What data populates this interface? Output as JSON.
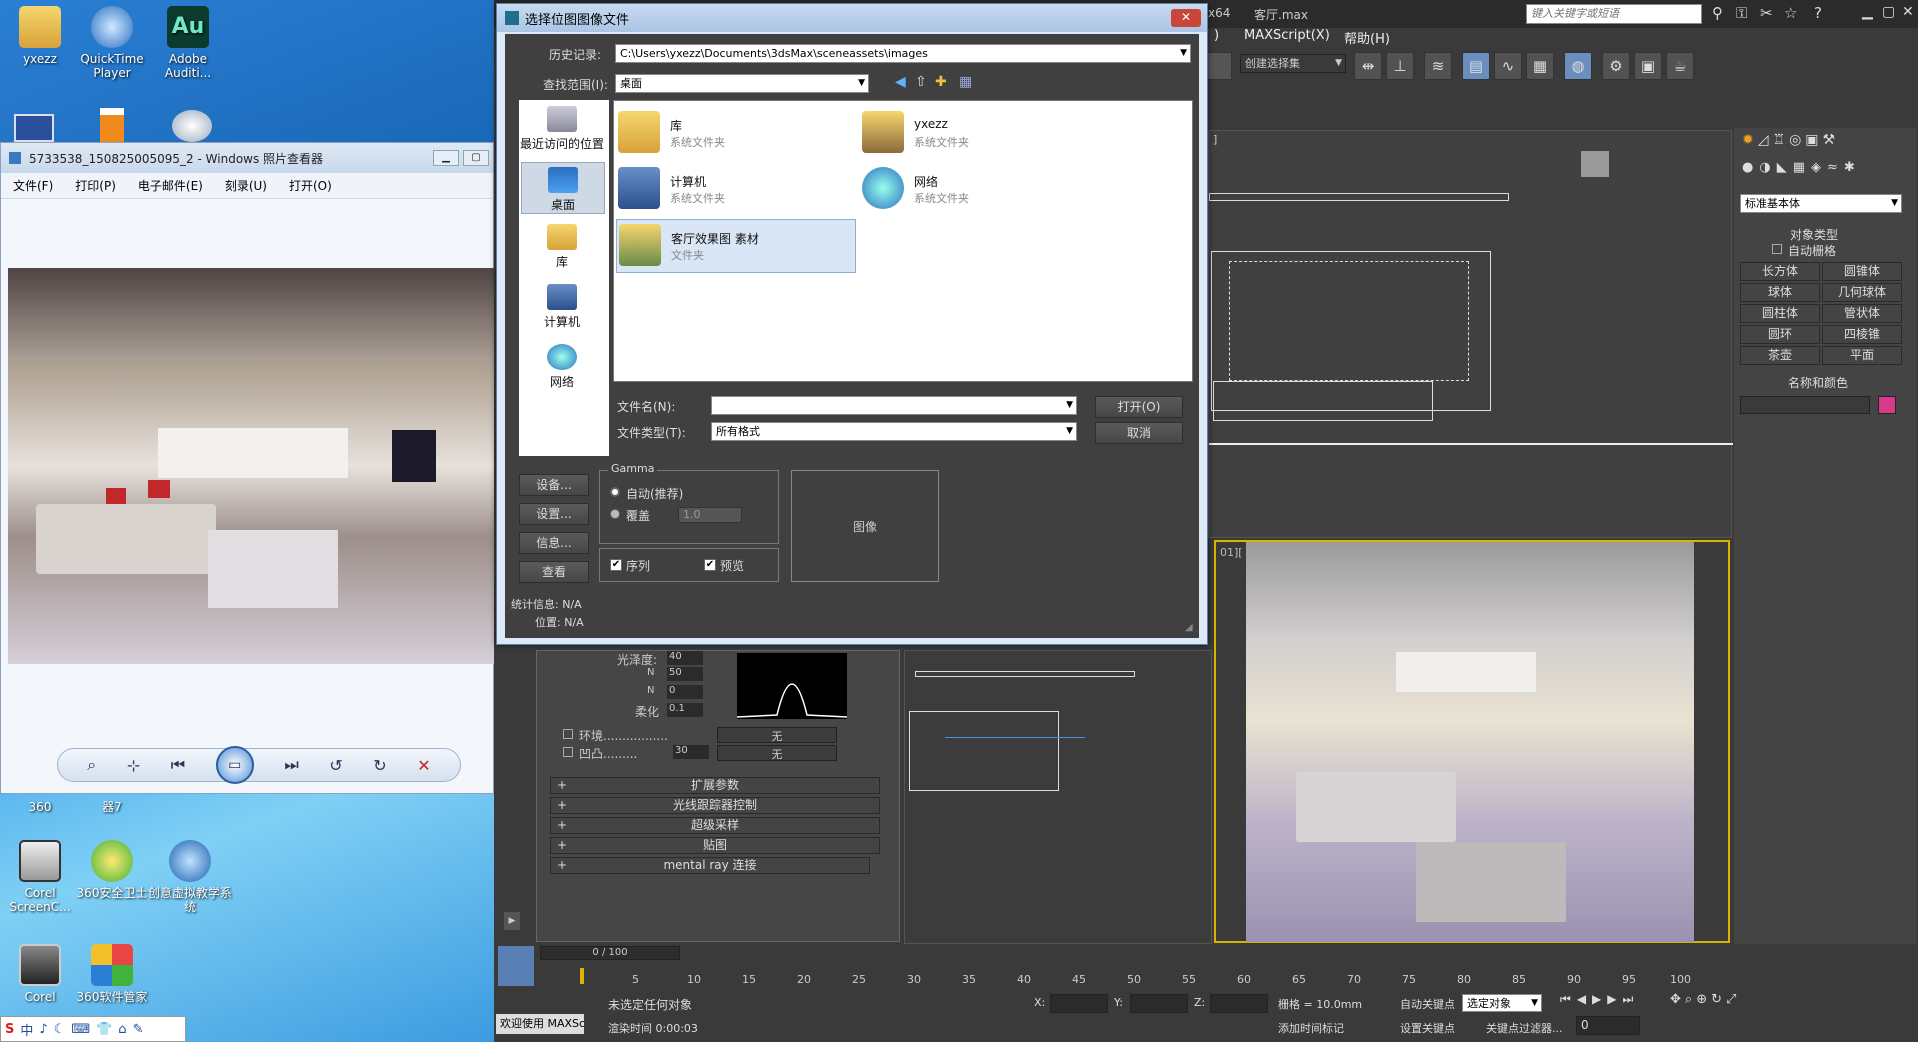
{
  "desktop": {
    "icons_top": [
      {
        "label": "yxezz"
      },
      {
        "label": "QuickTime Player"
      },
      {
        "label": "Adobe Auditi..."
      }
    ],
    "icons_mid": [
      {
        "label": "360"
      },
      {
        "label": "器7"
      }
    ],
    "icons_bottom": [
      {
        "label": "Corel ScreenC..."
      },
      {
        "label": "360安全卫士"
      },
      {
        "label": "创意虚拟教学系统"
      },
      {
        "label": "Corel"
      },
      {
        "label": "360软件管家"
      }
    ],
    "taskbar_icons": [
      "S",
      "中",
      "♪",
      "☾",
      "⌨",
      "👕",
      "⌂",
      "✎"
    ]
  },
  "viewer": {
    "title": "5733538_150825005095_2 - Windows 照片查看器",
    "menu": [
      "文件(F)",
      "打印(P)",
      "电子邮件(E)",
      "刻录(U)",
      "打开(O)"
    ]
  },
  "max": {
    "title_right": "x64",
    "file_title": "客厅.max",
    "search_placeholder": "键入关键字或短语",
    "menus": [
      ")",
      "MAXScript(X)",
      "帮助(H)"
    ],
    "selection_set": "创建选择集",
    "cp_dropdown": "标准基本体",
    "object_type_header": "对象类型",
    "auto_grid": "自动栅格",
    "object_types": [
      "长方体",
      "圆锥体",
      "球体",
      "几何球体",
      "圆柱体",
      "管状体",
      "圆环",
      "四棱锥",
      "茶壶",
      "平面"
    ],
    "name_color_header": "名称和颜色",
    "viewport_tl_label": "]",
    "viewport_br_label": "01][",
    "material": {
      "gloss_label": "光泽度:",
      "gloss_value": "40",
      "n1_label": "N",
      "n1_value": "50",
      "n2_label": "N",
      "n2_value": "0",
      "soften_label": "柔化",
      "soften_value": "0.1",
      "env_label": "环境.................",
      "env_value": "无",
      "bump_label": "凹凸.........",
      "bump_amount": "30",
      "bump_value": "无",
      "rollouts": [
        "扩展参数",
        "光线跟踪器控制",
        "超级采样",
        "贴图",
        "mental ray 连接"
      ]
    },
    "timeline": {
      "frame": "0 / 100",
      "ticks": [
        "5",
        "10",
        "15",
        "20",
        "25",
        "30",
        "35",
        "40",
        "45",
        "50",
        "55",
        "60",
        "65",
        "70",
        "75",
        "80",
        "85",
        "90",
        "95",
        "100"
      ]
    },
    "status": {
      "welcome": "欢迎使用 MAXSc",
      "no_selection": "未选定任何对象",
      "render_time": "渲染时间 0:00:03",
      "x": "X:",
      "y": "Y:",
      "z": "Z:",
      "grid": "栅格 = 10.0mm",
      "auto_key": "自动关键点",
      "set_key": "设置关键点",
      "selected_object": "选定对象",
      "key_filter": "关键点过滤器...",
      "add_time_tag": "添加时间标记",
      "frame_value": "0"
    }
  },
  "dialog": {
    "title": "选择位图图像文件",
    "history_label": "历史记录:",
    "history_value": "C:\\Users\\yxezz\\Documents\\3dsMax\\sceneassets\\images",
    "lookin_label": "查找范围(I):",
    "lookin_value": "桌面",
    "places": [
      {
        "label": "最近访问的位置"
      },
      {
        "label": "桌面"
      },
      {
        "label": "库"
      },
      {
        "label": "计算机"
      },
      {
        "label": "网络"
      }
    ],
    "items": [
      {
        "name": "库",
        "type": "系统文件夹"
      },
      {
        "name": "yxezz",
        "type": "系统文件夹"
      },
      {
        "name": "计算机",
        "type": "系统文件夹"
      },
      {
        "name": "网络",
        "type": "系统文件夹"
      },
      {
        "name": "客厅效果图  素材",
        "type": "文件夹"
      }
    ],
    "filename_label": "文件名(N):",
    "filename_value": "",
    "filetype_label": "文件类型(T):",
    "filetype_value": "所有格式",
    "open_label": "打开(O)",
    "cancel_label": "取消",
    "side_buttons": [
      "设备...",
      "设置...",
      "信息...",
      "查看"
    ],
    "gamma_label": "Gamma",
    "gamma_auto": "自动(推荐)",
    "gamma_override": "覆盖",
    "gamma_value": "1.0",
    "sequence_label": "序列",
    "preview_label": "预览",
    "image_label": "图像",
    "stats_label": "统计信息: N/A",
    "location_label": "位置: N/A"
  }
}
